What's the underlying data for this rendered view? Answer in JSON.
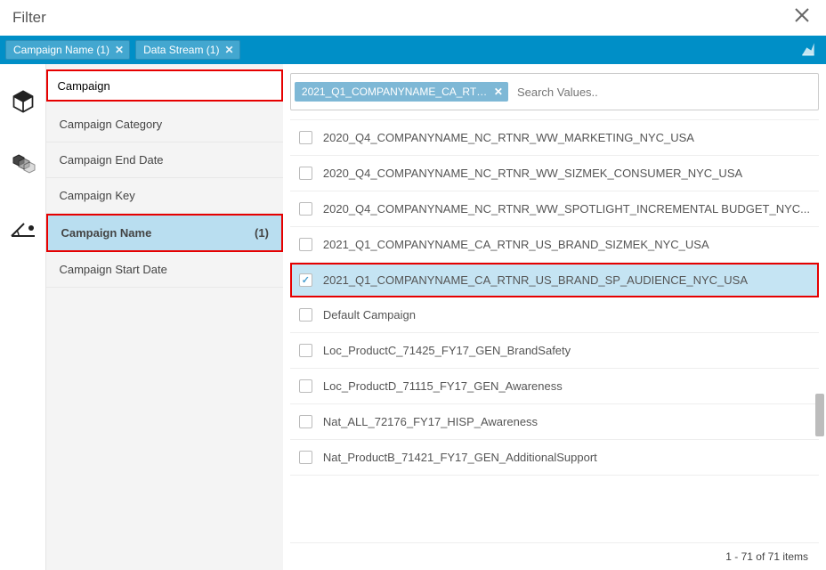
{
  "header": {
    "title": "Filter"
  },
  "filterBar": {
    "chips": [
      {
        "label": "Campaign Name (1)"
      },
      {
        "label": "Data Stream (1)"
      }
    ]
  },
  "leftPanel": {
    "searchValue": "Campaign",
    "attributes": [
      {
        "label": "Campaign Category",
        "selected": false
      },
      {
        "label": "Campaign End Date",
        "selected": false
      },
      {
        "label": "Campaign Key",
        "selected": false
      },
      {
        "label": "Campaign Name",
        "count": "(1)",
        "selected": true
      },
      {
        "label": "Campaign Start Date",
        "selected": false
      }
    ]
  },
  "rightPanel": {
    "selectedChip": "2021_Q1_COMPANYNAME_CA_RTNR_US...",
    "searchPlaceholder": "Search Values..",
    "values": [
      {
        "label": "2020_Q4_COMPANYNAME_NC_RTNR_WW_MARKETING_NYC_USA",
        "checked": false
      },
      {
        "label": "2020_Q4_COMPANYNAME_NC_RTNR_WW_SIZMEK_CONSUMER_NYC_USA",
        "checked": false
      },
      {
        "label": "2020_Q4_COMPANYNAME_NC_RTNR_WW_SPOTLIGHT_INCREMENTAL BUDGET_NYC...",
        "checked": false
      },
      {
        "label": "2021_Q1_COMPANYNAME_CA_RTNR_US_BRAND_SIZMEK_NYC_USA",
        "checked": false
      },
      {
        "label": "2021_Q1_COMPANYNAME_CA_RTNR_US_BRAND_SP_AUDIENCE_NYC_USA",
        "checked": true
      },
      {
        "label": "Default Campaign",
        "checked": false
      },
      {
        "label": "Loc_ProductC_71425_FY17_GEN_BrandSafety",
        "checked": false
      },
      {
        "label": "Loc_ProductD_71115_FY17_GEN_Awareness",
        "checked": false
      },
      {
        "label": "Nat_ALL_72176_FY17_HISP_Awareness",
        "checked": false
      },
      {
        "label": "Nat_ProductB_71421_FY17_GEN_AdditionalSupport",
        "checked": false
      }
    ],
    "footer": "1 - 71 of 71 items"
  }
}
